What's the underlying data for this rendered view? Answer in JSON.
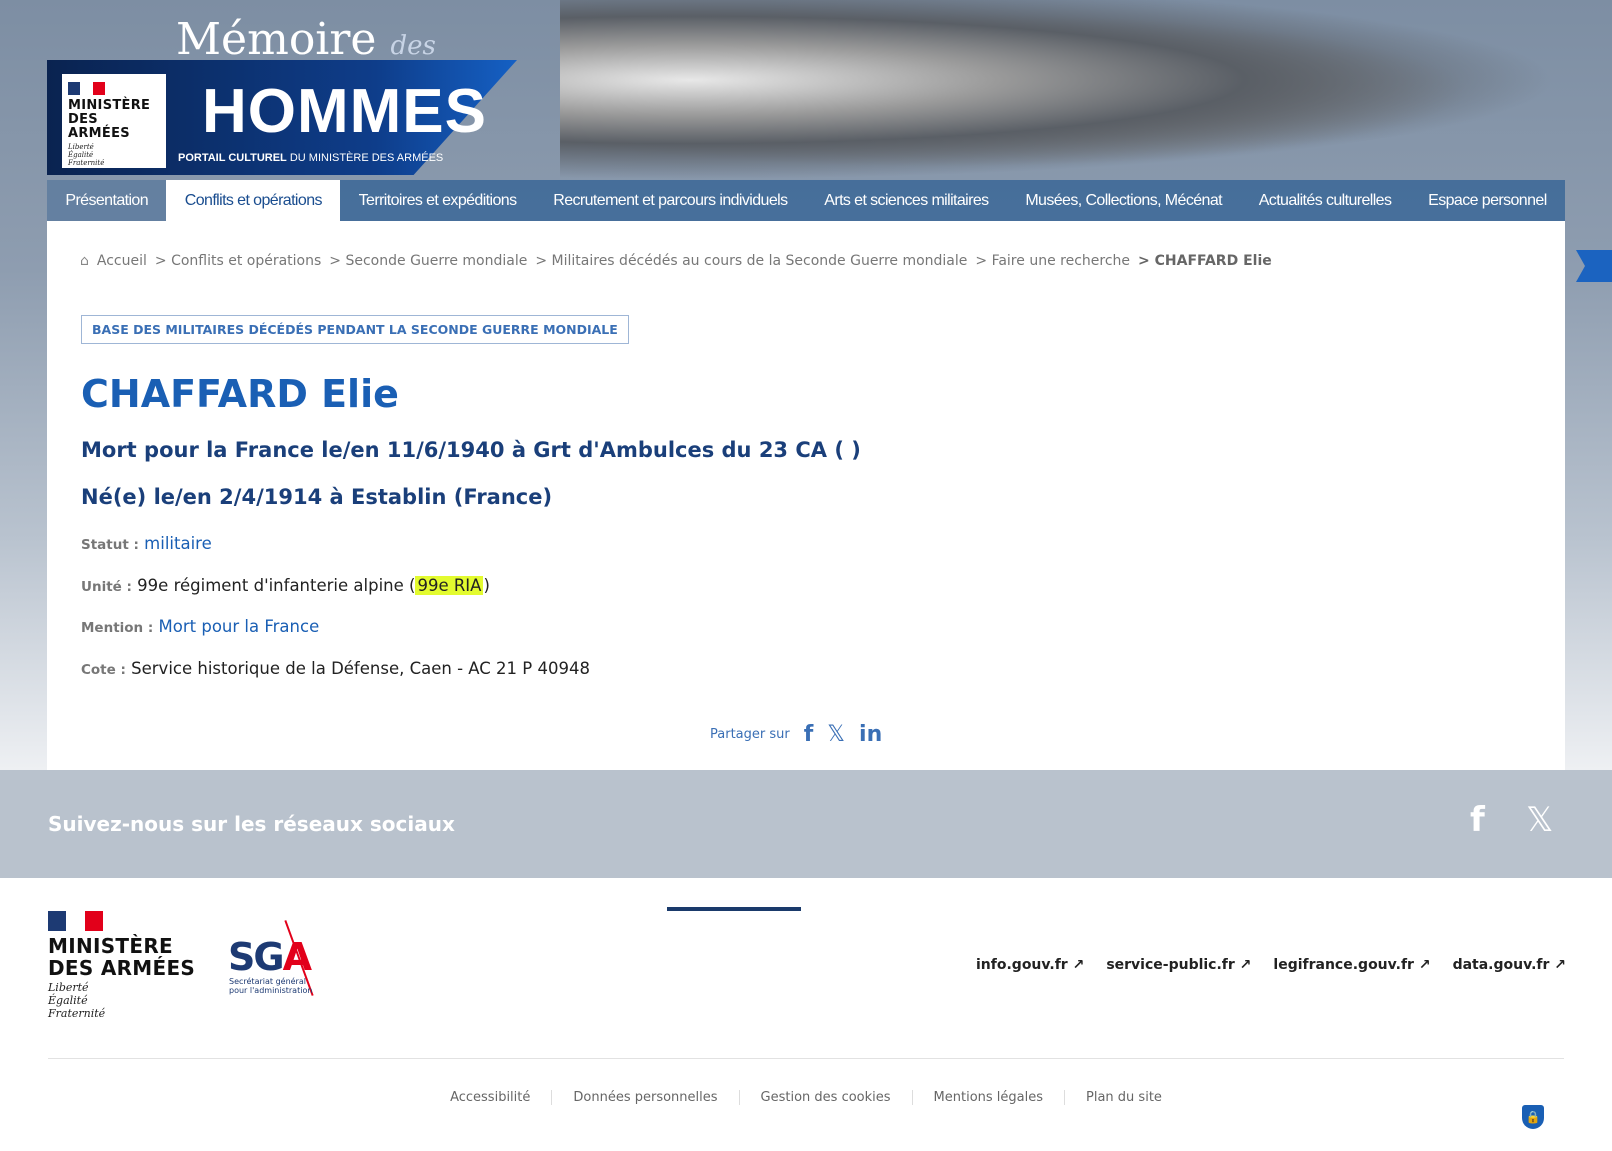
{
  "header": {
    "title_memoire": "Mémoire",
    "title_des": "des",
    "title_hommes": "HOMMES",
    "subtitle_bold": "PORTAIL CULTUREL",
    "subtitle_rest": " DU MINISTÈRE DES ARMÉES",
    "ministry_line1": "MINISTÈRE",
    "ministry_line2": "DES ARMÉES",
    "devise": [
      "Liberté",
      "Égalité",
      "Fraternité"
    ]
  },
  "nav": [
    "Présentation",
    "Conflits et opérations",
    "Territoires et expéditions",
    "Recrutement et parcours individuels",
    "Arts et sciences militaires",
    "Musées, Collections, Mécénat",
    "Actualités culturelles",
    "Espace personnel"
  ],
  "breadcrumb": [
    "Accueil",
    "> Conflits et opérations",
    "> Seconde Guerre mondiale",
    "> Militaires décédés au cours de la Seconde Guerre mondiale",
    "> Faire une recherche",
    "> CHAFFARD Elie"
  ],
  "badge": "BASE DES MILITAIRES DÉCÉDÉS PENDANT LA SECONDE GUERRE MONDIALE",
  "person": {
    "name": "CHAFFARD Elie",
    "death": "Mort pour la France le/en 11/6/1940 à Grt d'Ambulces du 23 CA ( )",
    "birth": "Né(e) le/en 2/4/1914 à Establin (France)",
    "statut_label": "Statut :",
    "statut": "militaire",
    "unite_label": "Unité :",
    "unite": "99e régiment d'infanterie alpine (",
    "unite_abbr": "99e RIA",
    "unite_close": ")",
    "mention_label": "Mention :",
    "mention": "Mort pour la France",
    "cote_label": "Cote :",
    "cote": "Service historique de la Défense, Caen - AC 21 P 40948"
  },
  "share": {
    "label": "Partager sur"
  },
  "social": {
    "title": "Suivez-nous sur les réseaux sociaux"
  },
  "footer": {
    "ministry_line1": "MINISTÈRE",
    "ministry_line2": "DES ARMÉES",
    "devise": [
      "Liberté",
      "Égalité",
      "Fraternité"
    ],
    "sga_sub1": "Secrétariat général",
    "sga_sub2": "pour l'administration",
    "links": [
      "info.gouv.fr ↗",
      "service-public.fr ↗",
      "legifrance.gouv.fr ↗",
      "data.gouv.fr ↗"
    ],
    "legal": [
      "Accessibilité",
      "Données personnelles",
      "Gestion des cookies",
      "Mentions légales",
      "Plan du site"
    ]
  },
  "colors": {
    "primary": "#1a5fb4",
    "highlight": "#e3fb2f"
  }
}
